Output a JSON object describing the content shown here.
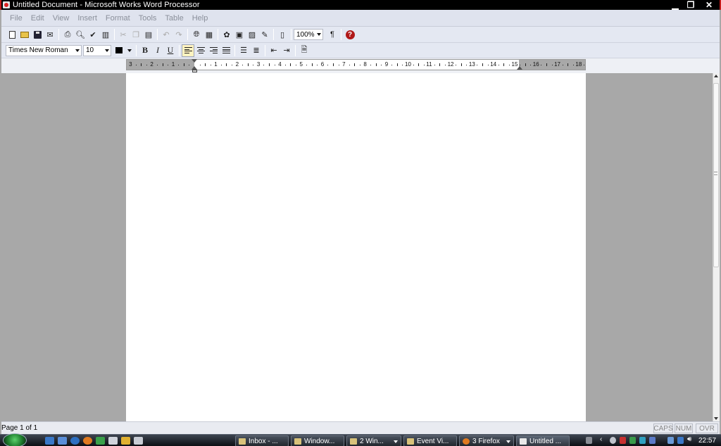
{
  "window": {
    "title": "Untitled Document - Microsoft Works Word Processor"
  },
  "menu": [
    "File",
    "Edit",
    "View",
    "Insert",
    "Format",
    "Tools",
    "Table",
    "Help"
  ],
  "toolbar": {
    "zoom_value": "100%",
    "pilcrow": "¶",
    "help": "?"
  },
  "format_bar": {
    "font_name": "Times New Roman",
    "font_size": "10",
    "bold": "B",
    "italic": "I",
    "underline": "U"
  },
  "ruler": {
    "labels": [
      "3",
      "2",
      "1",
      "1",
      "2",
      "3",
      "4",
      "5",
      "6",
      "7",
      "8",
      "9",
      "10",
      "11",
      "12",
      "13",
      "14",
      "15",
      "16",
      "17",
      "18"
    ]
  },
  "statusbar": {
    "page_info": "Page 1 of 1",
    "caps": "CAPS",
    "num": "NUM",
    "ovr": "OVR"
  },
  "taskbar": {
    "tasks": [
      "Inbox - ...",
      "Window...",
      "2 Win...",
      "Event Vi...",
      "3 Firefox",
      "Untitled ..."
    ],
    "clock": "22:57"
  },
  "colors": {
    "title_bar": "#000000",
    "window_border": "#c21a1a",
    "toolbar_bg": "#e4e8f2",
    "workspace_bg": "#a8a8a8"
  }
}
